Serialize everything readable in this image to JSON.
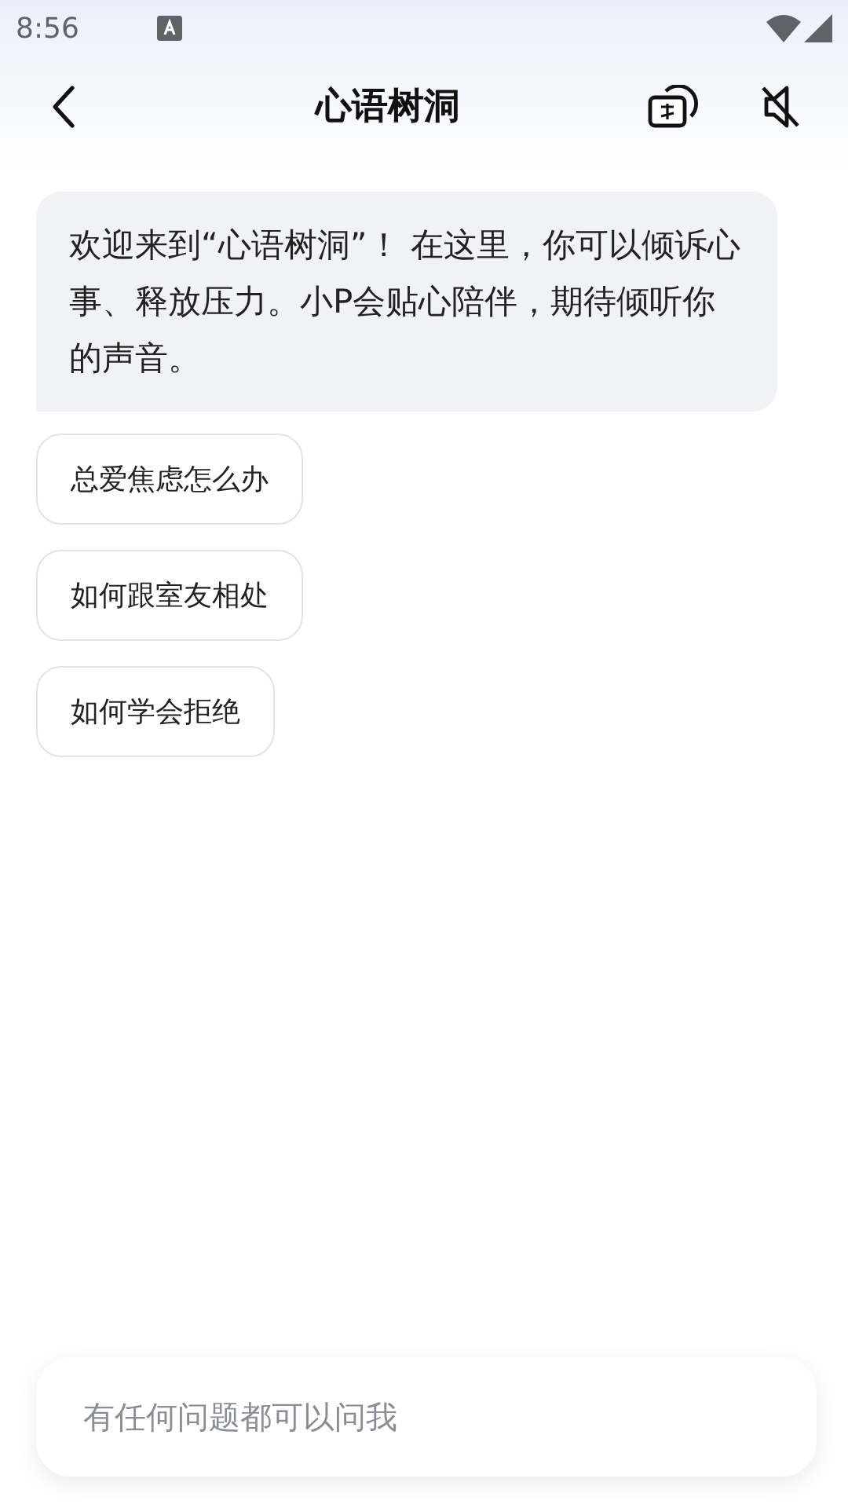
{
  "status_bar": {
    "time": "8:56"
  },
  "header": {
    "title": "心语树洞"
  },
  "welcome_message": "欢迎来到“心语树洞”！ 在这里，你可以倾诉心事、释放压力。小P会贴心陪伴，期待倾听你的声音。",
  "suggestions": [
    "总爱焦虑怎么办",
    "如何跟室友相处",
    "如何学会拒绝"
  ],
  "input": {
    "placeholder": "有任何问题都可以问我"
  }
}
